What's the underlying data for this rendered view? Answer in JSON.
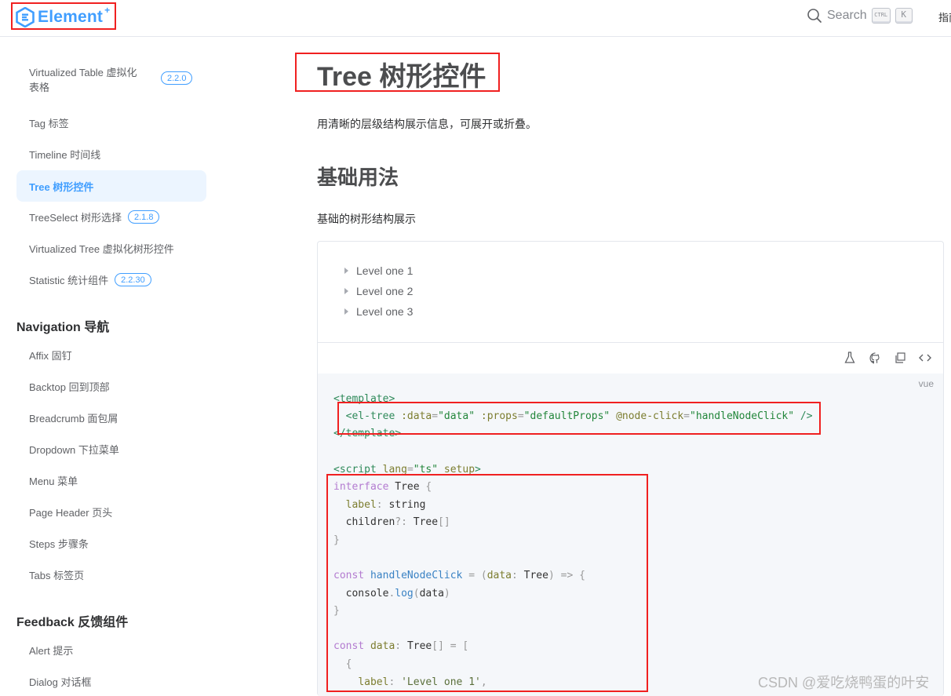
{
  "header": {
    "logo_text": "Element",
    "logo_plus": "+",
    "search_label": "Search",
    "kbd_ctrl": "CTRL",
    "kbd_k": "K",
    "nav_guide": "指南"
  },
  "sidebar": {
    "items_top": [
      {
        "label": "Virtualized Table 虚拟化表格",
        "badge": "2.2.0"
      },
      {
        "label": "Tag 标签"
      },
      {
        "label": "Timeline 时间线"
      },
      {
        "label": "Tree 树形控件",
        "active": true
      },
      {
        "label": "TreeSelect 树形选择",
        "badge": "2.1.8"
      },
      {
        "label": "Virtualized Tree 虚拟化树形控件"
      },
      {
        "label": "Statistic 统计组件",
        "badge": "2.2.30"
      }
    ],
    "group_navigation": "Navigation 导航",
    "items_navigation": [
      {
        "label": "Affix 固钉"
      },
      {
        "label": "Backtop 回到顶部"
      },
      {
        "label": "Breadcrumb 面包屑"
      },
      {
        "label": "Dropdown 下拉菜单"
      },
      {
        "label": "Menu 菜单"
      },
      {
        "label": "Page Header 页头"
      },
      {
        "label": "Steps 步骤条"
      },
      {
        "label": "Tabs 标签页"
      }
    ],
    "group_feedback": "Feedback 反馈组件",
    "items_feedback": [
      {
        "label": "Alert 提示"
      },
      {
        "label": "Dialog 对话框"
      }
    ]
  },
  "main": {
    "title": "Tree 树形控件",
    "description": "用清晰的层级结构展示信息，可展开或折叠。",
    "section_title": "基础用法",
    "section_desc": "基础的树形结构展示",
    "tree_nodes": [
      "Level one 1",
      "Level one 2",
      "Level one 3"
    ],
    "code_lang": "vue"
  },
  "watermark": "CSDN @爱吃烧鸭蛋的叶安",
  "colors": {
    "accent": "#409eff",
    "annotation": "#f02020"
  }
}
